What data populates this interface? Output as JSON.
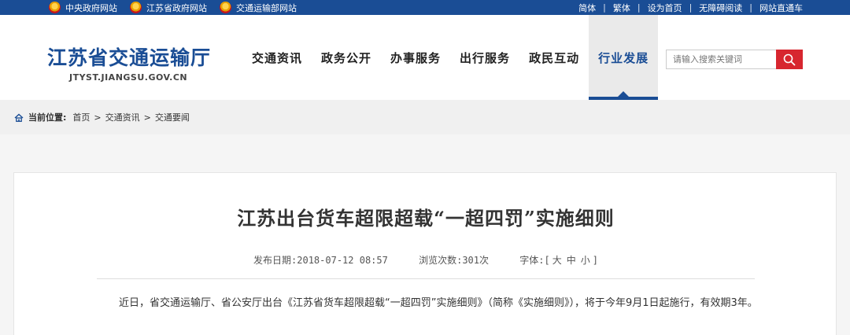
{
  "topbar": {
    "left_links": [
      {
        "label": "中央政府网站",
        "icon": "national-emblem-icon"
      },
      {
        "label": "江苏省政府网站",
        "icon": "national-emblem-icon"
      },
      {
        "label": "交通运输部网站",
        "icon": "national-emblem-icon"
      }
    ],
    "right_links": [
      "简体",
      "繁体",
      "设为首页",
      "无障碍阅读",
      "网站直通车"
    ],
    "separator": "|"
  },
  "header": {
    "logo_title": "江苏省交通运输厅",
    "logo_sub": "JTYST.JIANGSU.GOV.CN",
    "nav": [
      "交通资讯",
      "政务公开",
      "办事服务",
      "出行服务",
      "政民互动",
      "行业发展"
    ],
    "active_nav": "行业发展",
    "search_placeholder": "请输入搜索关键词",
    "accent_color": "#1a4d95",
    "search_button_color": "#d7262f"
  },
  "breadcrumb": {
    "label": "当前位置:",
    "items": [
      "首页",
      "交通资讯",
      "交通要闻"
    ],
    "arrow": ">"
  },
  "article": {
    "title": "江苏出台货车超限超载“一超四罚”实施细则",
    "publish_label": "发布日期:",
    "publish_date": "2018-07-12 08:57",
    "views_label": "浏览次数:",
    "views": "301次",
    "font_label": "字体:",
    "font_open": "[",
    "font_sizes": [
      "大",
      "中",
      "小"
    ],
    "font_close": "]",
    "paragraph": "近日，省交通运输厅、省公安厅出台《江苏省货车超限超载“一超四罚”实施细则》（简称《实施细则》），将于今年9月1日起施行，有效期3年。"
  }
}
